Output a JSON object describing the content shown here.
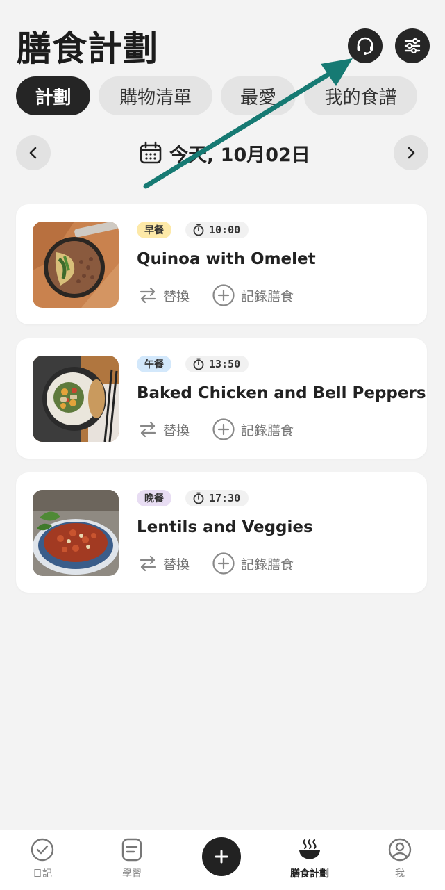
{
  "header": {
    "title": "膳食計劃",
    "support_icon": "headset-icon",
    "settings_icon": "sliders-icon"
  },
  "tabs": [
    {
      "label": "計劃",
      "active": true
    },
    {
      "label": "購物清單",
      "active": false
    },
    {
      "label": "最愛",
      "active": false
    },
    {
      "label": "我的食譜",
      "active": false
    }
  ],
  "date_nav": {
    "label": "今天, 10月02日",
    "prev_icon": "chevron-left-icon",
    "next_icon": "chevron-right-icon"
  },
  "meals": [
    {
      "tag": "早餐",
      "tag_color": "#fde9a8",
      "time": "10:00",
      "name": "Quinoa with Omelet",
      "swap_label": "替換",
      "log_label": "記錄膳食"
    },
    {
      "tag": "午餐",
      "tag_color": "#d3e8fb",
      "time": "13:50",
      "name": "Baked Chicken and Bell Peppers",
      "swap_label": "替換",
      "log_label": "記錄膳食"
    },
    {
      "tag": "晚餐",
      "tag_color": "#e8ddf3",
      "time": "17:30",
      "name": "Lentils and Veggies",
      "swap_label": "替換",
      "log_label": "記錄膳食"
    }
  ],
  "bottom_nav": [
    {
      "label": "日記",
      "icon": "check-circle-icon",
      "active": false
    },
    {
      "label": "學習",
      "icon": "document-icon",
      "active": false
    },
    {
      "label": "膳食計劃",
      "icon": "steaming-bowl-icon",
      "active": true
    },
    {
      "label": "我",
      "icon": "user-circle-icon",
      "active": false
    }
  ],
  "colors": {
    "annotation_arrow": "#167a73",
    "dark": "#252525"
  }
}
